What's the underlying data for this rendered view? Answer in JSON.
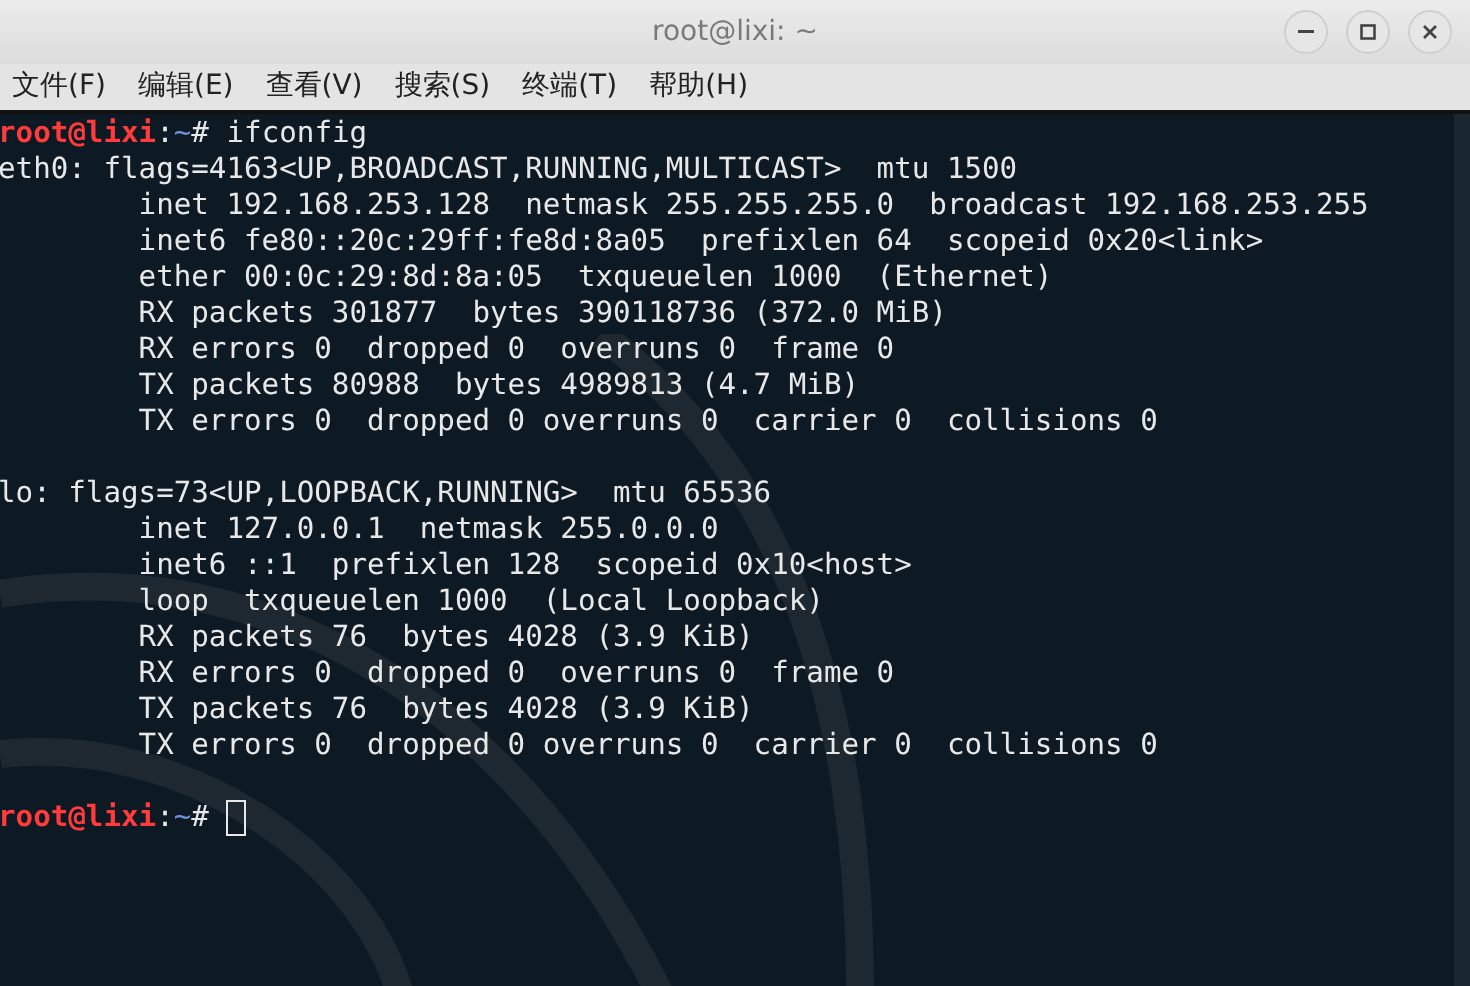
{
  "window": {
    "title": "root@lixi: ~"
  },
  "menu": [
    "文件(F)",
    "编辑(E)",
    "查看(V)",
    "搜索(S)",
    "终端(T)",
    "帮助(H)"
  ],
  "terminal": {
    "lines": [
      {
        "kind": "prompt",
        "user": "root@lixi",
        "sep": ":",
        "path": "~",
        "symbol": "#",
        "command": "ifconfig",
        "cursor": false
      },
      {
        "kind": "output",
        "text": "eth0: flags=4163<UP,BROADCAST,RUNNING,MULTICAST>  mtu 1500"
      },
      {
        "kind": "output",
        "text": "        inet 192.168.253.128  netmask 255.255.255.0  broadcast 192.168.253.255"
      },
      {
        "kind": "output",
        "text": "        inet6 fe80::20c:29ff:fe8d:8a05  prefixlen 64  scopeid 0x20<link>"
      },
      {
        "kind": "output",
        "text": "        ether 00:0c:29:8d:8a:05  txqueuelen 1000  (Ethernet)"
      },
      {
        "kind": "output",
        "text": "        RX packets 301877  bytes 390118736 (372.0 MiB)"
      },
      {
        "kind": "output",
        "text": "        RX errors 0  dropped 0  overruns 0  frame 0"
      },
      {
        "kind": "output",
        "text": "        TX packets 80988  bytes 4989813 (4.7 MiB)"
      },
      {
        "kind": "output",
        "text": "        TX errors 0  dropped 0 overruns 0  carrier 0  collisions 0"
      },
      {
        "kind": "blank"
      },
      {
        "kind": "output",
        "text": "lo: flags=73<UP,LOOPBACK,RUNNING>  mtu 65536"
      },
      {
        "kind": "output",
        "text": "        inet 127.0.0.1  netmask 255.0.0.0"
      },
      {
        "kind": "output",
        "text": "        inet6 ::1  prefixlen 128  scopeid 0x10<host>"
      },
      {
        "kind": "output",
        "text": "        loop  txqueuelen 1000  (Local Loopback)"
      },
      {
        "kind": "output",
        "text": "        RX packets 76  bytes 4028 (3.9 KiB)"
      },
      {
        "kind": "output",
        "text": "        RX errors 0  dropped 0  overruns 0  frame 0"
      },
      {
        "kind": "output",
        "text": "        TX packets 76  bytes 4028 (3.9 KiB)"
      },
      {
        "kind": "output",
        "text": "        TX errors 0  dropped 0 overruns 0  carrier 0  collisions 0"
      },
      {
        "kind": "blank"
      },
      {
        "kind": "prompt",
        "user": "root@lixi",
        "sep": ":",
        "path": "~",
        "symbol": "#",
        "cursor": true
      }
    ]
  }
}
